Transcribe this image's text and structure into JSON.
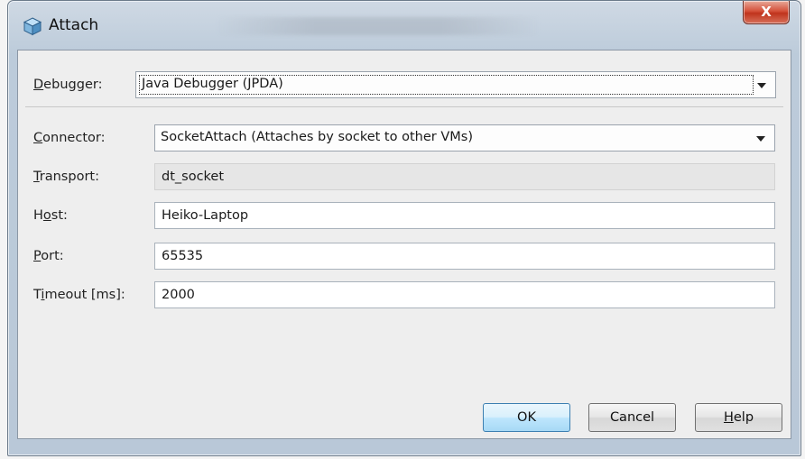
{
  "window": {
    "title": "Attach",
    "close_symbol": "X"
  },
  "form": {
    "debugger": {
      "label": "Debugger:",
      "value": "Java Debugger (JPDA)"
    },
    "connector": {
      "label": "Connector:",
      "value": "SocketAttach (Attaches by socket to other VMs)"
    },
    "transport": {
      "label": "Transport:",
      "value": "dt_socket"
    },
    "host": {
      "label": "Host:",
      "value": "Heiko-Laptop"
    },
    "port": {
      "label": "Port:",
      "value": "65535"
    },
    "timeout": {
      "label": "Timeout [ms]:",
      "value": "2000"
    }
  },
  "buttons": {
    "ok": "OK",
    "cancel": "Cancel",
    "help": "Help"
  },
  "icons": {
    "window": "netbeans-cube-icon",
    "dropdown": "chevron-down-icon",
    "close": "close-icon"
  },
  "colors": {
    "default_button_border": "#3c7fb1",
    "close_button": "#c0341d"
  }
}
